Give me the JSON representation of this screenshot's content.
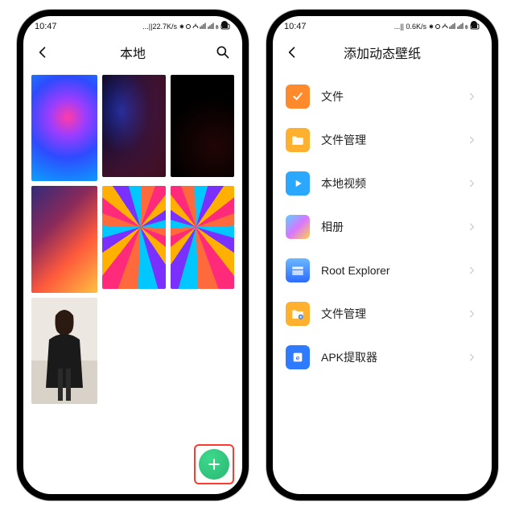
{
  "left": {
    "status": {
      "time": "10:47",
      "net": "...||22.7K/s",
      "icons": "✱ ⦿ ⏰ 📶 📶 ฿ ▭"
    },
    "header": {
      "title": "本地"
    },
    "fab": {
      "label": "+"
    },
    "thumbs": [
      "wp1",
      "wp2",
      "wp3",
      "wp4",
      "wp5",
      "wp6",
      "wp7"
    ]
  },
  "right": {
    "status": {
      "time": "10:47",
      "net": "...|| 0.6K/s",
      "icons": "✱ ⦿ ⏰ 📶 📶 ฿ ▭"
    },
    "header": {
      "title": "添加动态壁纸"
    },
    "rows": [
      {
        "label": "文件"
      },
      {
        "label": "文件管理"
      },
      {
        "label": "本地视频"
      },
      {
        "label": "相册"
      },
      {
        "label": "Root Explorer"
      },
      {
        "label": "文件管理"
      },
      {
        "label": "APK提取器"
      }
    ]
  }
}
